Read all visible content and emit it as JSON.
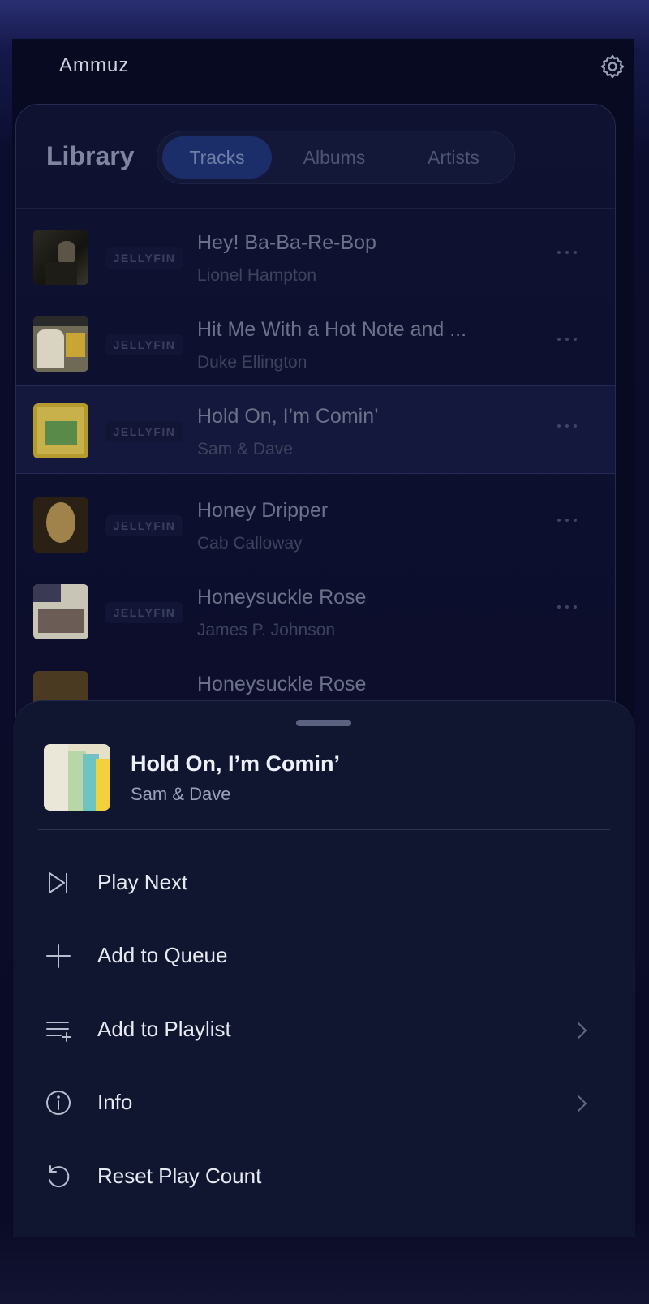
{
  "app": {
    "name": "Ammuz"
  },
  "library": {
    "title": "Library",
    "tabs": [
      {
        "label": "Tracks",
        "active": true
      },
      {
        "label": "Albums",
        "active": false
      },
      {
        "label": "Artists",
        "active": false
      }
    ],
    "tracks": [
      {
        "title": "Hey! Ba-Ba-Re-Bop",
        "artist": "Lionel Hampton",
        "source": "JELLYFIN",
        "selected": false
      },
      {
        "title": "Hit Me With a Hot Note and ...",
        "artist": "Duke Ellington",
        "source": "JELLYFIN",
        "selected": false
      },
      {
        "title": "Hold On, I’m Comin’",
        "artist": "Sam & Dave",
        "source": "JELLYFIN",
        "selected": true
      },
      {
        "title": "Honey Dripper",
        "artist": "Cab Calloway",
        "source": "JELLYFIN",
        "selected": false
      },
      {
        "title": "Honeysuckle Rose",
        "artist": "James P. Johnson",
        "source": "JELLYFIN",
        "selected": false
      },
      {
        "title": "Honeysuckle Rose",
        "artist": "",
        "source": "",
        "selected": false
      }
    ]
  },
  "sheet": {
    "track_title": "Hold On, I’m Comin’",
    "track_artist": "Sam & Dave",
    "actions": [
      {
        "label": "Play Next",
        "icon": "play-next-icon",
        "has_chevron": false
      },
      {
        "label": "Add to Queue",
        "icon": "plus-icon",
        "has_chevron": false
      },
      {
        "label": "Add to Playlist",
        "icon": "playlist-add-icon",
        "has_chevron": true
      },
      {
        "label": "Info",
        "icon": "info-icon",
        "has_chevron": true
      },
      {
        "label": "Reset Play Count",
        "icon": "reset-icon",
        "has_chevron": false
      }
    ]
  },
  "colors": {
    "accent": "#1b2e6a",
    "logo_start": "#e0457b",
    "logo_end": "#f0a040",
    "sheet_bg": "#101530"
  }
}
